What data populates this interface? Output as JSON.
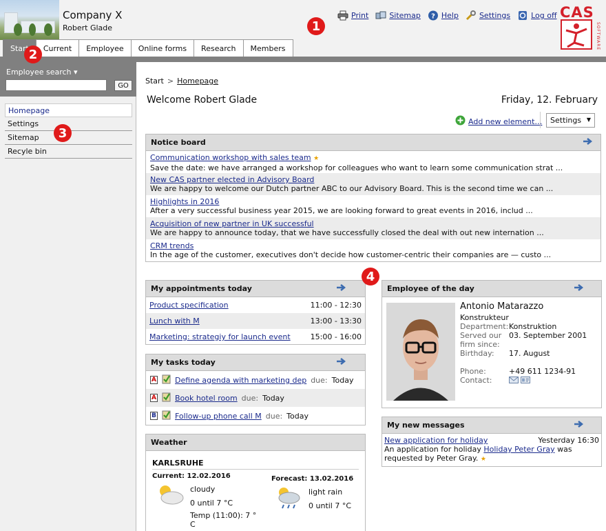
{
  "header": {
    "company": "Company X",
    "user": "Robert Glade",
    "links": [
      {
        "label": "Print",
        "icon": "printer-icon"
      },
      {
        "label": "Sitemap",
        "icon": "sitemap-icon"
      },
      {
        "label": "Help",
        "icon": "help-icon"
      },
      {
        "label": "Settings",
        "icon": "wrench-icon"
      },
      {
        "label": "Log off",
        "icon": "logoff-icon"
      }
    ],
    "logo_text": "CAS",
    "logo_sub": "SOFTWARE"
  },
  "callouts": [
    "1",
    "2",
    "3",
    "4"
  ],
  "tabs": [
    "Start",
    "Current",
    "Employee",
    "Online forms",
    "Research",
    "Members"
  ],
  "sidebar": {
    "search_label": "Employee search ▾",
    "search_value": "",
    "go": "GO",
    "items": [
      "Homepage",
      "Settings",
      "Sitemap",
      "Recyle bin"
    ]
  },
  "main": {
    "breadcrumb": {
      "start": "Start",
      "sep": ">",
      "current": "Homepage"
    },
    "welcome": "Welcome Robert Glade",
    "date": "Friday, 12. February",
    "add_element": "Add new element…",
    "settings": "Settings"
  },
  "notice_board": {
    "title": "Notice board",
    "items": [
      {
        "title": "Communication workshop with sales team",
        "desc": "Save the date: we have arranged a workshop for colleagues who want to learn some communication strat ..."
      },
      {
        "title": "New CAS partner elected in Advisory Board",
        "desc": "We are happy to welcome our Dutch partner ABC to our Advisory Board. This is the second time we can ..."
      },
      {
        "title": "Highlights in 2016",
        "desc": "After a very successful business year 2015, we are looking forward to great events in 2016, includ ..."
      },
      {
        "title": "Acquisition of new partner in UK successful",
        "desc": "We are happy to announce today, that we have successfully closed the deal with out new internation ..."
      },
      {
        "title": "CRM trends",
        "desc": "In the age of the customer, executives don't decide how customer-centric their companies are — custo ..."
      }
    ]
  },
  "appointments": {
    "title": "My appointments today",
    "rows": [
      {
        "name": "Product specification",
        "time": "11:00 - 12:30"
      },
      {
        "name": "Lunch with M",
        "time": "13:00 - 13:30"
      },
      {
        "name": "Marketing: strategiy for launch event",
        "time": "15:00 - 16:00"
      }
    ]
  },
  "tasks": {
    "title": "My tasks today",
    "due_label": "due:",
    "rows": [
      {
        "prio": "A",
        "name": "Define agenda with marketing dep",
        "due": "Today"
      },
      {
        "prio": "A",
        "name": "Book hotel room",
        "due": "Today"
      },
      {
        "prio": "B",
        "name": "Follow-up phone call M",
        "due": "Today"
      }
    ]
  },
  "weather": {
    "title": "Weather",
    "city": "KARLSRUHE",
    "current": {
      "label": "Current: 12.02.2016",
      "cond": "cloudy",
      "temp": "0 until 7 °C",
      "extra1": "Temp (11:00): 7 °",
      "extra2": "C"
    },
    "forecast": {
      "label": "Forecast: 13.02.2016",
      "cond": "light rain",
      "temp": "0 until 7 °C"
    }
  },
  "employee_of_day": {
    "title": "Employee of the day",
    "name": "Antonio Matarazzo",
    "role": "Konstrukteur",
    "fields": [
      {
        "k": "Department:",
        "v": "Konstruktion"
      },
      {
        "k": "Served our",
        "v": "03. September 2001"
      },
      {
        "k": "firm since:",
        "v": ""
      },
      {
        "k": "Birthday:",
        "v": "17. August"
      },
      {
        "k": "Phone:",
        "v": "+49 611 1234-91"
      },
      {
        "k": "Contact:",
        "v": ""
      }
    ]
  },
  "messages": {
    "title": "My new messages",
    "subject": "New application for holiday",
    "time": "Yesterday 16:30",
    "body_pre": "An application for holiday ",
    "body_link": "Holiday Peter Gray",
    "body_post": " was requested by Peter Gray."
  },
  "colors": {
    "header_bg": "#f2f2f2",
    "tab_active": "#808080",
    "panel_head": "#dcdcdc",
    "link": "#1a2a8c",
    "callout": "#e01a1a"
  }
}
